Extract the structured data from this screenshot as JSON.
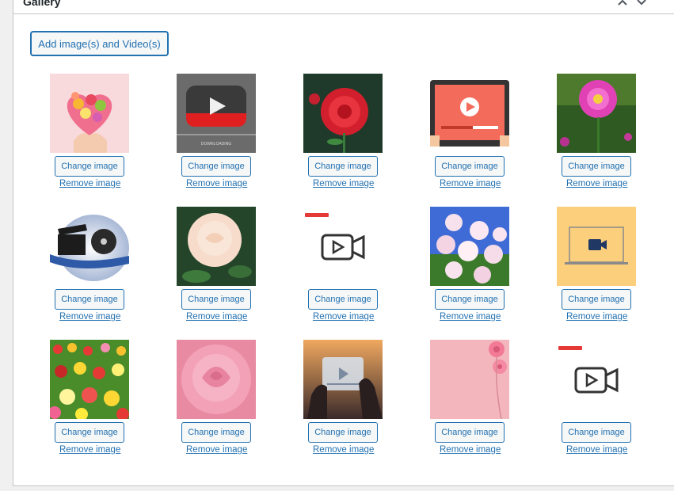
{
  "panel": {
    "title": "Gallery"
  },
  "toolbar": {
    "add_label": "Add image(s) and Video(s)"
  },
  "gallery": {
    "change_label": "Change image",
    "remove_label": "Remove image",
    "items": [
      {
        "name": "heart-bouquet-image",
        "kind": "photo"
      },
      {
        "name": "youtube-downloading-image",
        "kind": "photo"
      },
      {
        "name": "red-dahlia-image",
        "kind": "photo"
      },
      {
        "name": "video-player-tablet-image",
        "kind": "photo"
      },
      {
        "name": "pink-dahlia-image",
        "kind": "photo"
      },
      {
        "name": "film-clapper-reel-image",
        "kind": "photo"
      },
      {
        "name": "white-rose-image",
        "kind": "photo"
      },
      {
        "name": "video-placeholder-icon",
        "kind": "video"
      },
      {
        "name": "white-daisies-image",
        "kind": "photo"
      },
      {
        "name": "laptop-video-camera-image",
        "kind": "photo"
      },
      {
        "name": "tulip-field-image",
        "kind": "photo"
      },
      {
        "name": "pink-rose-image",
        "kind": "photo"
      },
      {
        "name": "phone-video-hands-image",
        "kind": "photo"
      },
      {
        "name": "pink-gerbera-image",
        "kind": "photo"
      },
      {
        "name": "video-placeholder-icon",
        "kind": "video"
      }
    ]
  }
}
